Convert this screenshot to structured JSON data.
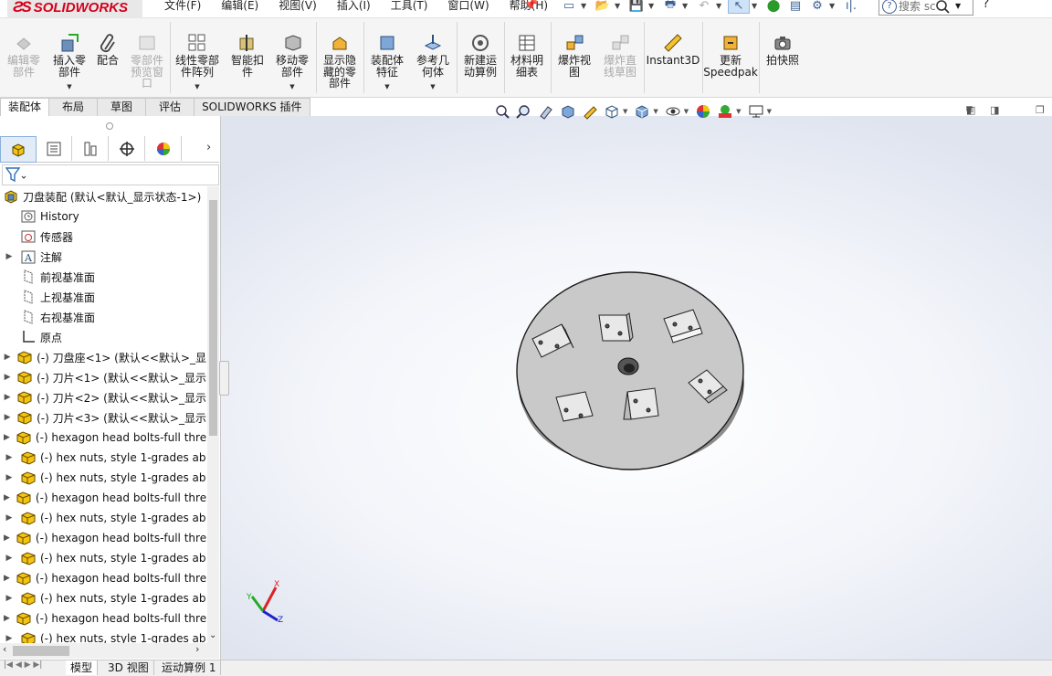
{
  "app": {
    "logo_text": "SOLIDWORKS"
  },
  "menu": [
    "文件(F)",
    "编辑(E)",
    "视图(V)",
    "插入(I)",
    "工具(T)",
    "窗口(W)",
    "帮助(H)"
  ],
  "search": {
    "placeholder": "搜索 sc",
    "help": "?"
  },
  "ribbon": {
    "buttons": [
      {
        "label": "编辑零\n部件",
        "disabled": true
      },
      {
        "label": "插入零\n部件",
        "disabled": false
      },
      {
        "label": "配合",
        "disabled": false
      },
      {
        "label": "零部件\n预览窗\n口",
        "disabled": true
      },
      {
        "label": "线性零部\n件阵列",
        "disabled": false
      },
      {
        "label": "智能扣\n件",
        "disabled": false
      },
      {
        "label": "移动零\n部件",
        "disabled": false
      },
      {
        "label": "显示隐\n藏的零\n部件",
        "disabled": false
      },
      {
        "label": "装配体\n特征",
        "disabled": false
      },
      {
        "label": "参考几\n何体",
        "disabled": false
      },
      {
        "label": "新建运\n动算例",
        "disabled": false
      },
      {
        "label": "材料明\n细表",
        "disabled": false
      },
      {
        "label": "爆炸视\n图",
        "disabled": false
      },
      {
        "label": "爆炸直\n线草图",
        "disabled": true
      },
      {
        "label": "Instant3D",
        "disabled": false
      },
      {
        "label": "更新\nSpeedpak",
        "disabled": false
      },
      {
        "label": "拍快照",
        "disabled": false
      }
    ]
  },
  "command_tabs": [
    "装配体",
    "布局",
    "草图",
    "评估",
    "SOLIDWORKS 插件"
  ],
  "feature_tree": {
    "root": "刀盘装配  (默认<默认_显示状态-1>)",
    "items": [
      "History",
      "传感器",
      "注解",
      "前视基准面",
      "上视基准面",
      "右视基准面",
      "原点",
      "(-) 刀盘座<1> (默认<<默认>_显",
      "(-) 刀片<1> (默认<<默认>_显示",
      "(-) 刀片<2> (默认<<默认>_显示",
      "(-) 刀片<3> (默认<<默认>_显示",
      "(-) hexagon head bolts-full thre",
      "(-) hex nuts, style 1-grades ab",
      "(-) hex nuts, style 1-grades ab",
      "(-) hexagon head bolts-full thre",
      "(-) hex nuts, style 1-grades ab",
      "(-) hexagon head bolts-full thre",
      "(-) hex nuts, style 1-grades ab",
      "(-) hexagon head bolts-full thre",
      "(-) hex nuts, style 1-grades ab",
      "(-) hexagon head bolts-full thre",
      "(-) hex nuts, style 1-grades ab"
    ]
  },
  "triad": {
    "x": "X",
    "y": "Y",
    "z": "Z"
  },
  "bottom_tabs": [
    "模型",
    "3D 视图",
    "运动算例 1"
  ],
  "colors": {
    "brand": "#d6001c",
    "part_yellow": "#f2c511",
    "disc": "#c9c9c9"
  }
}
